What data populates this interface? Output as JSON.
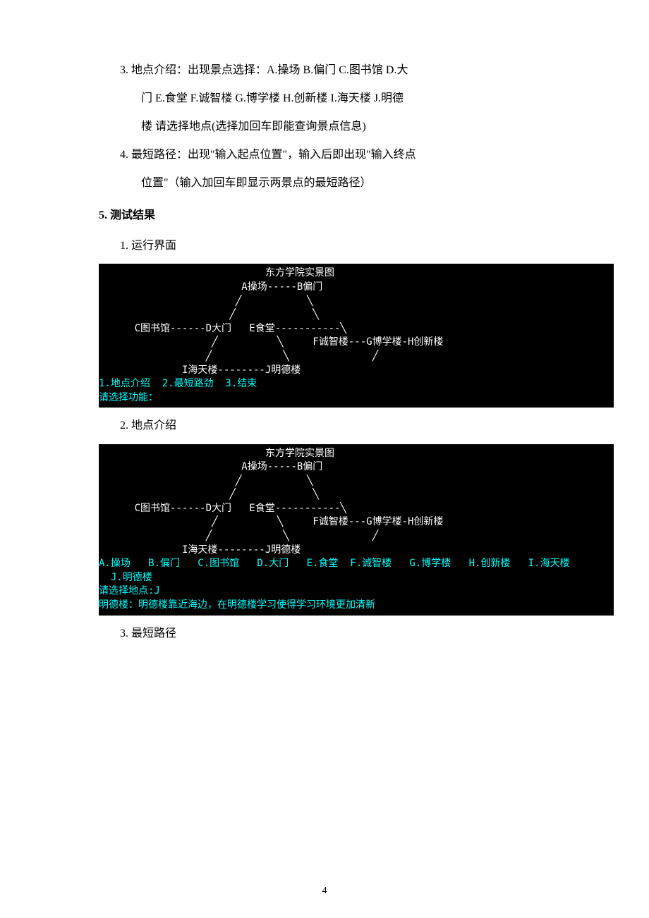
{
  "item3": {
    "num": "3.",
    "line1": "地点介绍：出现景点选择：A.操场   B.偏门   C.图书馆   D.大",
    "line2": "门   E.食堂 F.诚智楼   G.博学楼   H.创新楼   I.海天楼   J.明德",
    "line3": "楼   请选择地点(选择加回车即能查询景点信息)"
  },
  "item4": {
    "num": "4.",
    "line1": "最短路径：出现\"输入起点位置\"，输入后即出现\"输入终点",
    "line2": "位置\"（输入加回车即显示两景点的最短路径）"
  },
  "section5": {
    "num": "5.",
    "title": "测试结果",
    "sub1": {
      "num": "1.",
      "label": "运行界面"
    },
    "sub2": {
      "num": "2.",
      "label": "地点介绍"
    },
    "sub3": {
      "num": "3.",
      "label": "最短路径"
    }
  },
  "console1": {
    "title": "                            东方学院实景图",
    "l1": "                        A操场-----B偏门",
    "l2": "                       ╱           ╲",
    "l3": "                      ╱             ╲",
    "l4": "      C图书馆------D大门   E食堂-----------╲",
    "l5": "                   ╱          ╲     F诚智楼---G博学楼-H创新楼",
    "l6": "                  ╱            ╲              ╱",
    "l7": "              I海天楼--------J明德楼",
    "menu": "1.地点介绍  2.最短路劲  3.结束",
    "prompt": "请选择功能："
  },
  "console2": {
    "title": "                            东方学院实景图",
    "l1": "                        A操场-----B偏门",
    "l2": "                       ╱           ╲",
    "l3": "                      ╱             ╲",
    "l4": "      C图书馆------D大门   E食堂-----------╲",
    "l5": "                   ╱          ╲     F诚智楼---G博学楼-H创新楼",
    "l6": "                  ╱            ╲              ╱",
    "l7": "              I海天楼--------J明德楼",
    "opts1": "A.操场   B.偏门   C.图书馆   D.大门   E.食堂  F.诚智楼   G.博学楼   H.创新楼   I.海天楼",
    "opts2": "  J.明德楼",
    "prompt": "请选择地点:J",
    "result": "明德楼：明德楼靠近海边，在明德楼学习使得学习环境更加清新"
  },
  "pageNumber": "4"
}
